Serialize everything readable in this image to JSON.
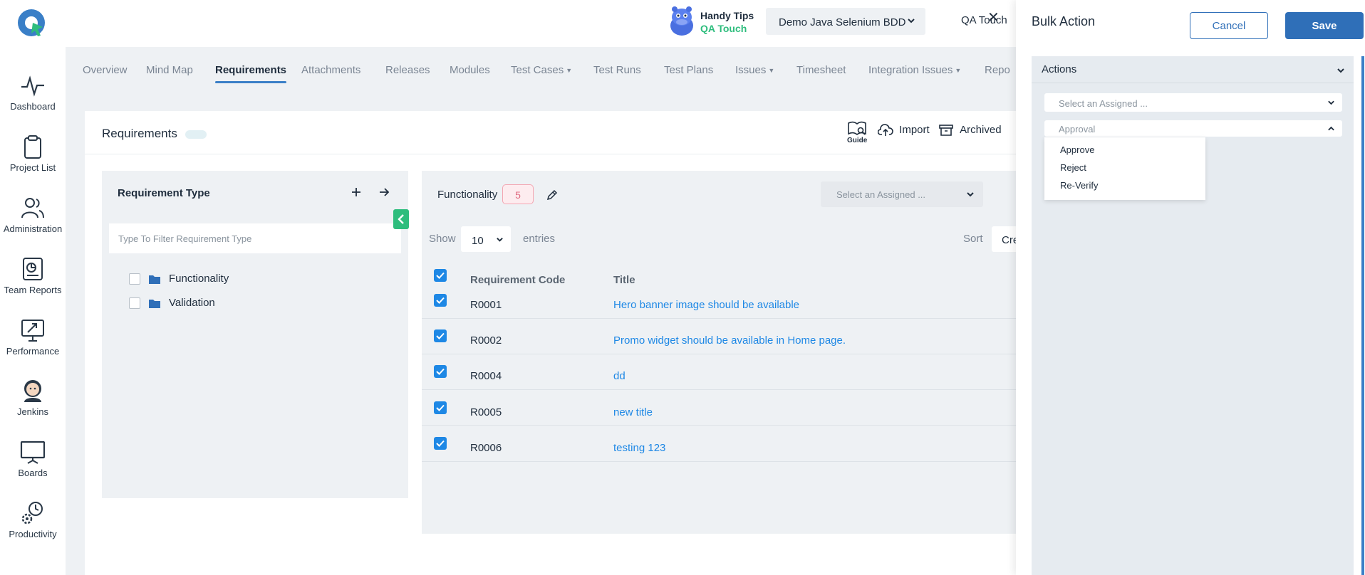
{
  "sidebar": {
    "items": [
      {
        "label": "Dashboard"
      },
      {
        "label": "Project List"
      },
      {
        "label": "Administration"
      },
      {
        "label": "Team Reports"
      },
      {
        "label": "Performance"
      },
      {
        "label": "Jenkins"
      },
      {
        "label": "Boards"
      },
      {
        "label": "Productivity"
      }
    ]
  },
  "topbar": {
    "handy_tips_line1": "Handy Tips",
    "handy_tips_line2": "QA Touch",
    "project": "Demo Java Selenium BDD",
    "user": "QA Touch"
  },
  "tabs": [
    {
      "label": "Overview"
    },
    {
      "label": "Mind Map"
    },
    {
      "label": "Requirements"
    },
    {
      "label": "Attachments"
    },
    {
      "label": "Releases"
    },
    {
      "label": "Modules"
    },
    {
      "label": "Test Cases"
    },
    {
      "label": "Test Runs"
    },
    {
      "label": "Test Plans"
    },
    {
      "label": "Issues"
    },
    {
      "label": "Timesheet"
    },
    {
      "label": "Integration Issues"
    },
    {
      "label": "Repo"
    }
  ],
  "card": {
    "title": "Requirements",
    "guide": "Guide",
    "import": "Import",
    "archived": "Archived"
  },
  "req_type": {
    "title": "Requirement Type",
    "filter_placeholder": "Type To Filter Requirement Type",
    "items": [
      "Functionality",
      "Validation"
    ]
  },
  "list": {
    "group": "Functionality",
    "count": "5",
    "assign_placeholder": "Select an Assigned ...",
    "show": "Show",
    "page_size": "10",
    "entries": "entries",
    "sort": "Sort",
    "sort_value": "Crea",
    "columns": [
      "Requirement Code",
      "Title"
    ],
    "rows": [
      {
        "code": "R0001",
        "title": "Hero banner image should be available"
      },
      {
        "code": "R0002",
        "title": "Promo widget should be available in Home page."
      },
      {
        "code": "R0004",
        "title": "dd"
      },
      {
        "code": "R0005",
        "title": "new title"
      },
      {
        "code": "R0006",
        "title": "testing 123"
      }
    ]
  },
  "drawer": {
    "title": "Bulk Action",
    "cancel": "Cancel",
    "save": "Save",
    "section": "Actions",
    "assign_placeholder": "Select an Assigned ...",
    "approval_placeholder": "Approval",
    "approval_options": [
      "Approve",
      "Reject",
      "Re-Verify"
    ]
  },
  "colors": {
    "primary": "#2f6fb8",
    "link": "#1e88e5",
    "accent_green": "#2ebd7d",
    "panel_bg": "#eef1f4"
  }
}
